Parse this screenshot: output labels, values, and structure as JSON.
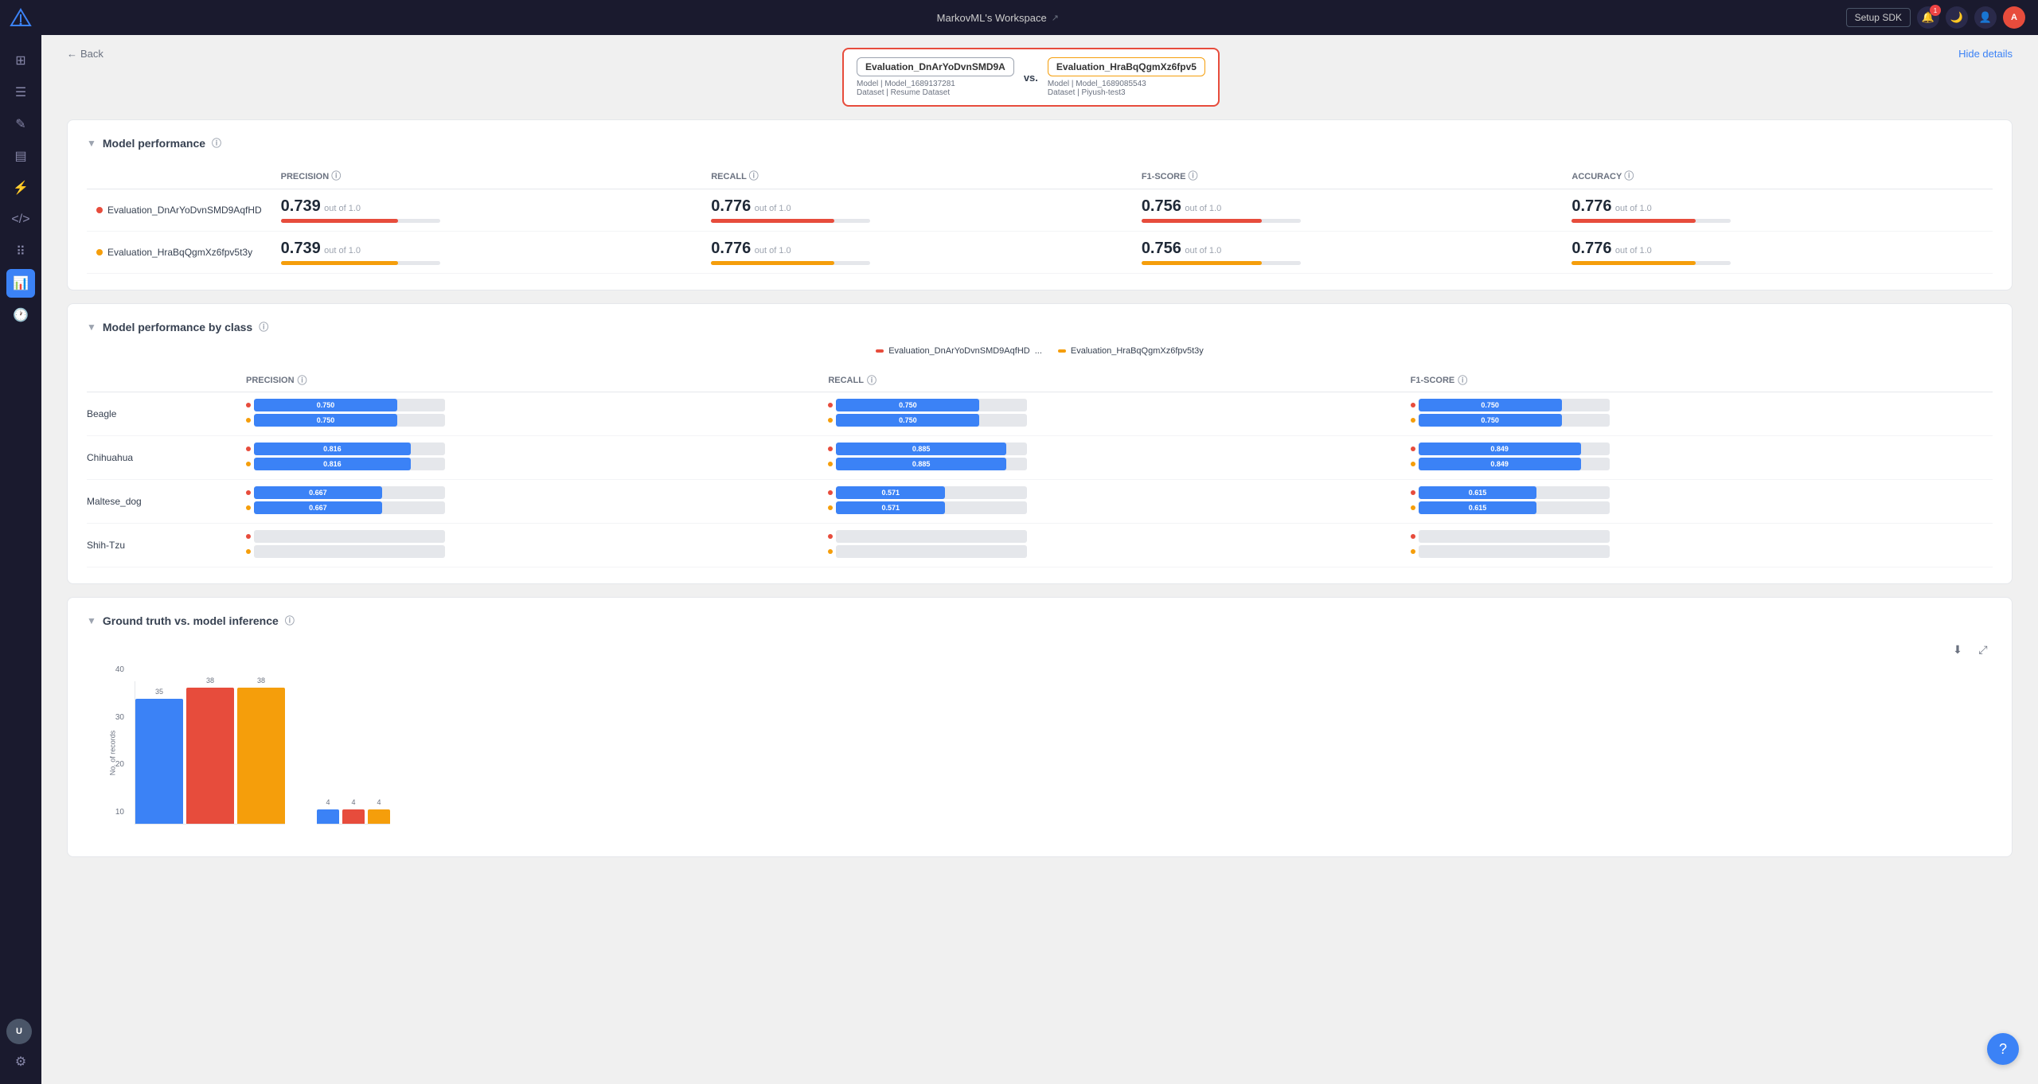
{
  "app": {
    "title": "MarkovML's Workspace",
    "setup_sdk": "Setup SDK"
  },
  "topbar": {
    "notification_count": "1",
    "user_initials": "A"
  },
  "back_link": "Back",
  "hide_details": "Hide details",
  "eval1": {
    "name": "Evaluation_DnArYoDvnSMD9A",
    "full_name": "Evaluation_DnArYoDvnSMD9AqfHD",
    "model": "Model_1689137281",
    "dataset": "Resume Dataset",
    "dot_color": "#e74c3c"
  },
  "eval2": {
    "name": "Evaluation_HraBqQgmXz6fpv5",
    "full_name": "Evaluation_HraBqQgmXz6fpv5t3y",
    "model": "Model_1689085543",
    "dataset": "Piyush-test3",
    "dot_color": "#f59e0b"
  },
  "vs_label": "vs.",
  "sections": {
    "model_performance": {
      "title": "Model performance",
      "columns": [
        "PRECISION",
        "RECALL",
        "F1-SCORE",
        "ACCURACY"
      ],
      "rows": [
        {
          "name": "Evaluation_DnArYoDvnSMD9AqfHD",
          "dot_color": "#e74c3c",
          "precision": "0.739",
          "precision_sub": "out of 1.0",
          "precision_bar": 73.9,
          "precision_bar_color": "#e74c3c",
          "recall": "0.776",
          "recall_sub": "out of 1.0",
          "recall_bar": 77.6,
          "recall_bar_color": "#e74c3c",
          "f1": "0.756",
          "f1_sub": "out of 1.0",
          "f1_bar": 75.6,
          "f1_bar_color": "#e74c3c",
          "accuracy": "0.776",
          "accuracy_sub": "out of 1.0",
          "accuracy_bar": 77.6,
          "accuracy_bar_color": "#e74c3c"
        },
        {
          "name": "Evaluation_HraBqQgmXz6fpv5t3y",
          "dot_color": "#f59e0b",
          "precision": "0.739",
          "precision_sub": "out of 1.0",
          "precision_bar": 73.9,
          "precision_bar_color": "#f59e0b",
          "recall": "0.776",
          "recall_sub": "out of 1.0",
          "recall_bar": 77.6,
          "recall_bar_color": "#f59e0b",
          "f1": "0.756",
          "f1_sub": "out of 1.0",
          "f1_bar": 75.6,
          "f1_bar_color": "#f59e0b",
          "accuracy": "0.776",
          "accuracy_sub": "out of 1.0",
          "accuracy_bar": 77.6,
          "accuracy_bar_color": "#f59e0b"
        }
      ]
    },
    "model_performance_by_class": {
      "title": "Model performance by class",
      "columns": [
        "PRECISION",
        "RECALL",
        "F1-SCORE"
      ],
      "classes": [
        {
          "name": "Beagle",
          "precision1": 0.75,
          "precision1_label": "0.750",
          "precision2": 0.75,
          "precision2_label": "0.750",
          "recall1": 0.75,
          "recall1_label": "0.750",
          "recall2": 0.75,
          "recall2_label": "0.750",
          "f1_1": 0.75,
          "f1_1_label": "0.750",
          "f1_2": 0.75,
          "f1_2_label": "0.750"
        },
        {
          "name": "Chihuahua",
          "precision1": 0.816,
          "precision1_label": "0.816",
          "precision2": 0.816,
          "precision2_label": "0.816",
          "recall1": 0.885,
          "recall1_label": "0.885",
          "recall2": 0.885,
          "recall2_label": "0.885",
          "f1_1": 0.849,
          "f1_1_label": "0.849",
          "f1_2": 0.849,
          "f1_2_label": "0.849"
        },
        {
          "name": "Maltese_dog",
          "precision1": 0.667,
          "precision1_label": "0.667",
          "precision2": 0.667,
          "precision2_label": "0.667",
          "recall1": 0.571,
          "recall1_label": "0.571",
          "recall2": 0.571,
          "recall2_label": "0.571",
          "f1_1": 0.615,
          "f1_1_label": "0.615",
          "f1_2": 0.615,
          "f1_2_label": "0.615"
        },
        {
          "name": "Shih-Tzu",
          "precision1": 0,
          "precision1_label": "",
          "precision2": 0,
          "precision2_label": "",
          "recall1": 0,
          "recall1_label": "",
          "recall2": 0,
          "recall2_label": "",
          "f1_1": 0,
          "f1_1_label": "",
          "f1_2": 0,
          "f1_2_label": ""
        }
      ]
    },
    "ground_truth": {
      "title": "Ground truth vs. model inference",
      "y_labels": [
        "40",
        "30",
        "20",
        "10"
      ],
      "bars": [
        {
          "label": "35",
          "value": 35,
          "color": "#3b82f6",
          "x_label": ""
        },
        {
          "label": "38",
          "value": 38,
          "color": "#e74c3c",
          "x_label": ""
        },
        {
          "label": "38",
          "value": 38,
          "color": "#f59e0b",
          "x_label": ""
        }
      ],
      "small_bars_label": [
        "4",
        "4",
        "4"
      ],
      "y_axis_label": "No. of records"
    }
  },
  "sidebar": {
    "items": [
      {
        "icon": "⊞",
        "name": "grid"
      },
      {
        "icon": "☰",
        "name": "menu"
      },
      {
        "icon": "✏",
        "name": "edit"
      },
      {
        "icon": "☰",
        "name": "list"
      },
      {
        "icon": "⚙",
        "name": "settings-icon"
      },
      {
        "icon": "📊",
        "name": "chart"
      },
      {
        "icon": "🕐",
        "name": "history"
      }
    ]
  }
}
